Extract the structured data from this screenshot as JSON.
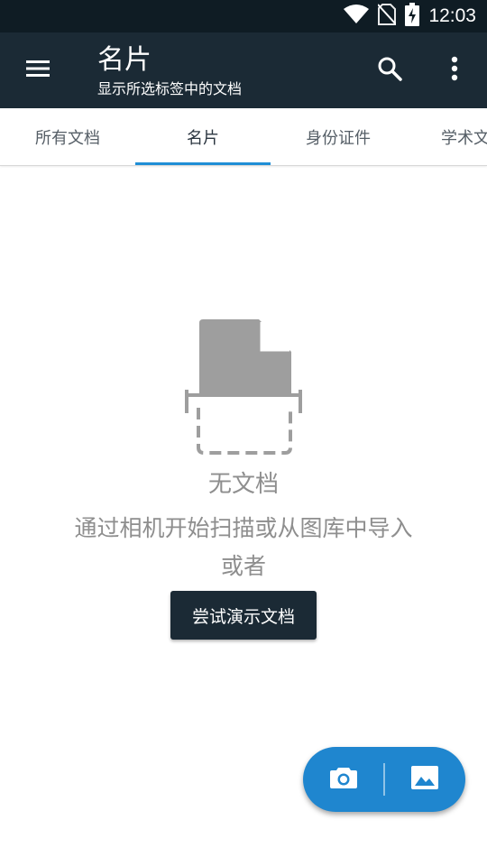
{
  "status_bar": {
    "time": "12:03",
    "icons": [
      "wifi-icon",
      "no-sim-icon",
      "battery-charging-icon"
    ]
  },
  "app_bar": {
    "title": "名片",
    "subtitle": "显示所选标签中的文档",
    "icons": [
      "menu-icon",
      "search-icon",
      "more-vert-icon"
    ]
  },
  "tabs": [
    {
      "label": "所有文档",
      "selected": false
    },
    {
      "label": "名片",
      "selected": true
    },
    {
      "label": "身份证件",
      "selected": false
    },
    {
      "label": "学术文",
      "selected": false
    }
  ],
  "empty_state": {
    "title": "无文档",
    "hint": "通过相机开始扫描或从图库中导入",
    "or_text": "或者",
    "demo_button": "尝试演示文档"
  },
  "fab": {
    "icons": [
      "camera-icon",
      "gallery-icon"
    ]
  },
  "colors": {
    "status_bar": "#0f1c24",
    "app_bar": "#1b2a35",
    "accent": "#1f8ed6",
    "fab": "#1f86cf",
    "muted_text": "#8e8e8e",
    "illustration": "#9e9e9e"
  }
}
